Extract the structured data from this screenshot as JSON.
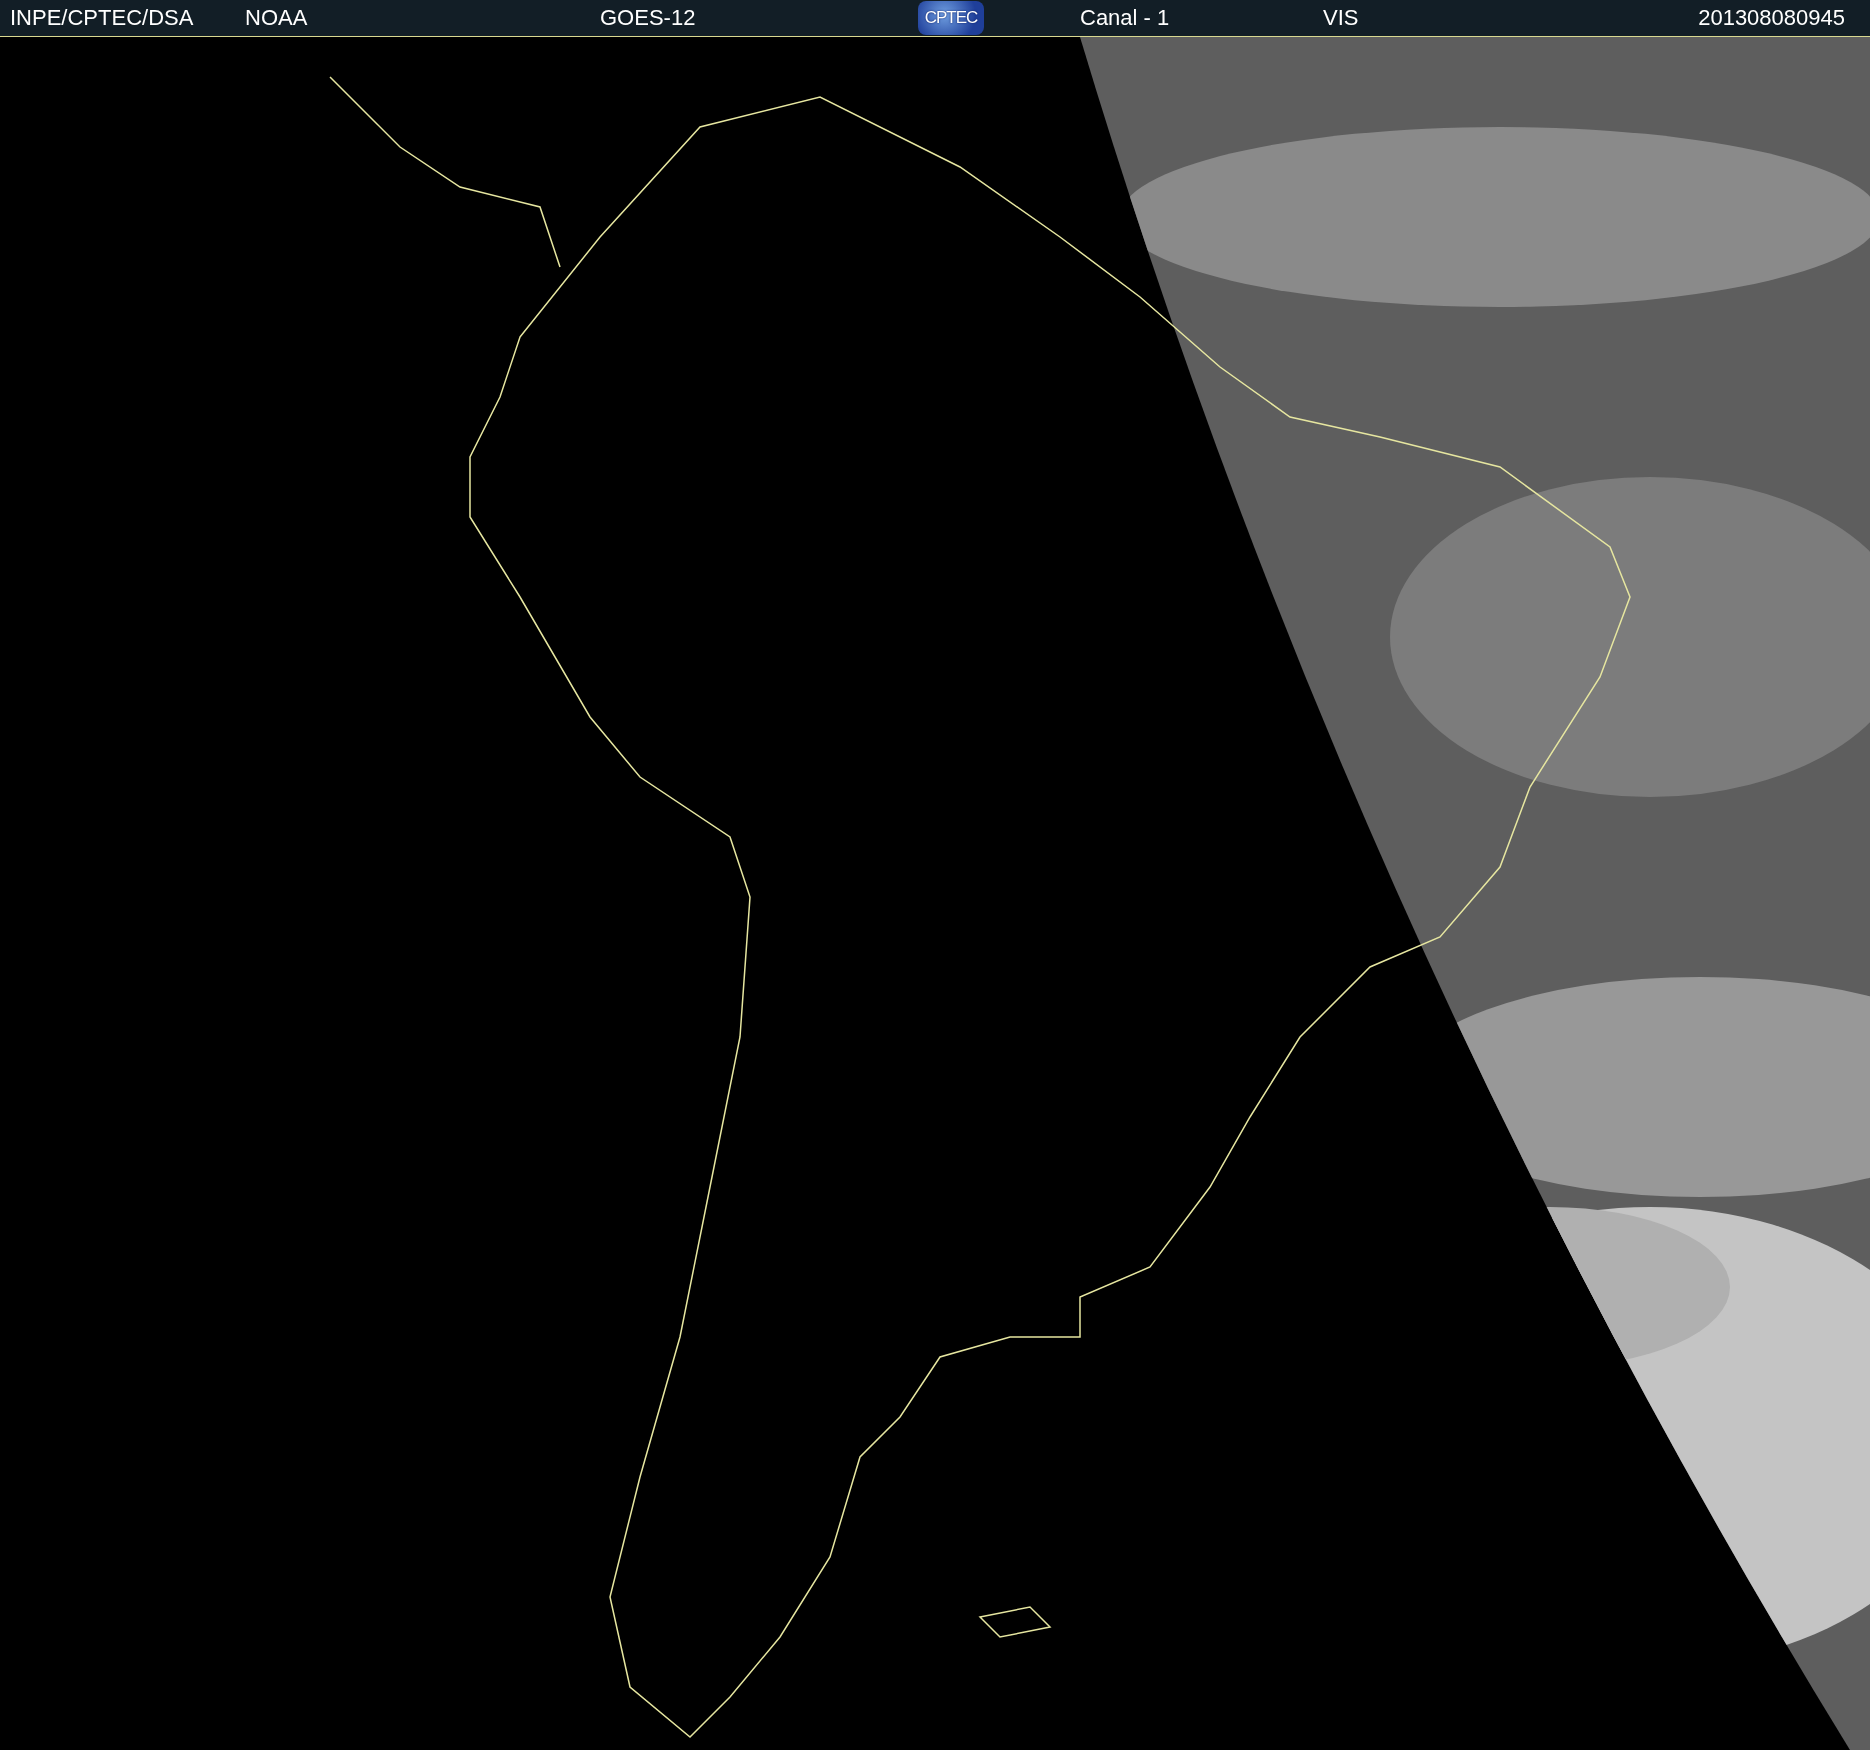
{
  "header": {
    "source": "INPE/CPTEC/DSA",
    "agency": "NOAA",
    "satellite": "GOES-12",
    "logo": "CPTEC",
    "channel": "Canal - 1",
    "band": "VIS",
    "timestamp": "201308080945"
  }
}
